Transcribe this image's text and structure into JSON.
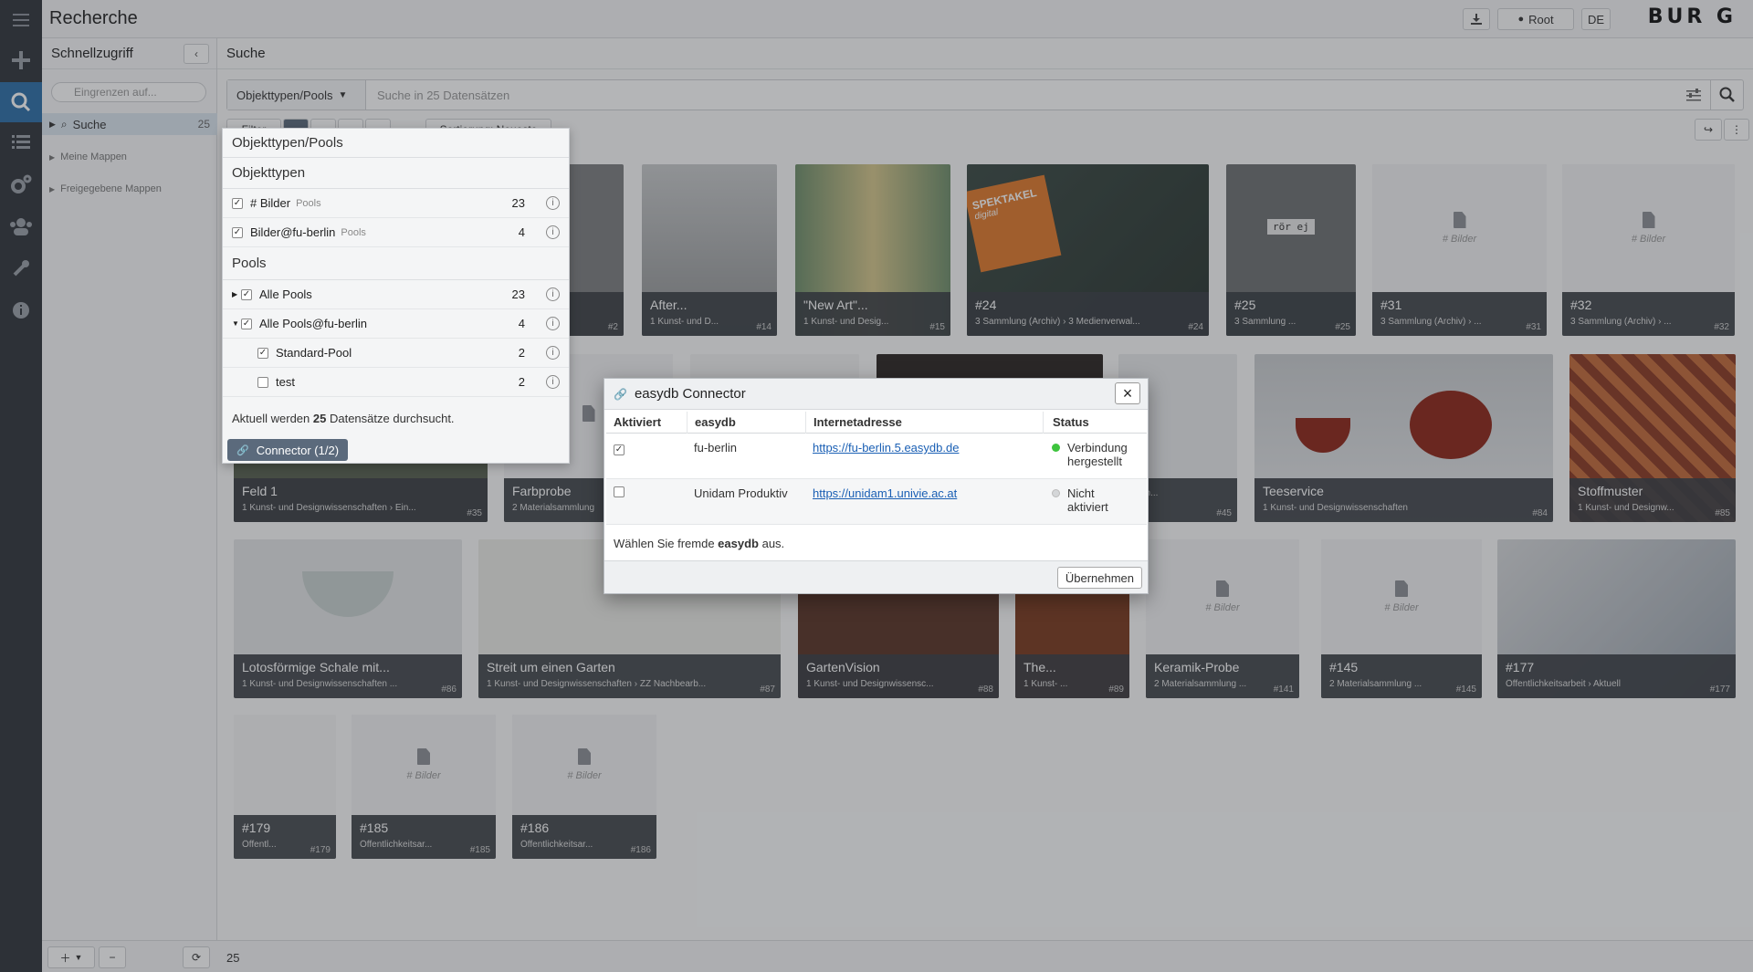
{
  "app": {
    "title": "Recherche",
    "user_label": "Root",
    "language": "DE",
    "logo_text": "BUR G"
  },
  "rail": {
    "items": [
      "menu-icon",
      "plus-icon",
      "search-icon",
      "list-icon",
      "gears-icon",
      "users-icon",
      "wrench-icon",
      "info-icon"
    ]
  },
  "left_panel": {
    "title": "Schnellzugriff",
    "filter_placeholder": "Eingrenzen auf...",
    "items": [
      {
        "label": "Suche",
        "count": "25"
      },
      {
        "label": "Meine Mappen"
      },
      {
        "label": "Freigegebene Mappen"
      }
    ]
  },
  "main": {
    "title": "Suche",
    "pool_select": "Objekttypen/Pools",
    "search_placeholder": "Suche in 25 Datensätzen",
    "filter_label": "Filter",
    "sort_label": "Sortierung: Neueste"
  },
  "tiles": [
    {
      "title": "",
      "sub": "",
      "num": "#2"
    },
    {
      "title": "After...",
      "sub": "1 Kunst- und D...",
      "num": "#14"
    },
    {
      "title": "\"New Art\"...",
      "sub": "1 Kunst- und Desig...",
      "num": "#15"
    },
    {
      "title": "#24",
      "sub": "3 Sammlung (Archiv) › 3 Medienverwal...",
      "num": "#24"
    },
    {
      "title": "#25",
      "sub": "3 Sammlung ...",
      "num": "#25"
    },
    {
      "title": "#31",
      "sub": "3 Sammlung (Archiv) › ...",
      "num": "#31",
      "ph": "# Bilder"
    },
    {
      "title": "#32",
      "sub": "3 Sammlung (Archiv) › ...",
      "num": "#32",
      "ph": "# Bilder"
    },
    {
      "title": "Feld 1",
      "sub": "1 Kunst- und Designwissenschaften › Ein...",
      "num": "#35"
    },
    {
      "title": "Farbprobe",
      "sub": "2 Materialsammlung",
      "num": ""
    },
    {
      "title": "",
      "sub": "...tlich...",
      "num": "#45"
    },
    {
      "title": "Teeservice",
      "sub": "1 Kunst- und Designwissenschaften",
      "num": "#84"
    },
    {
      "title": "Stoffmuster",
      "sub": "1 Kunst- und Designw...",
      "num": "#85"
    },
    {
      "title": "Lotosförmige Schale mit...",
      "sub": "1 Kunst- und Designwissenschaften ...",
      "num": "#86"
    },
    {
      "title": "Streit um einen Garten",
      "sub": "1 Kunst- und Designwissenschaften › ZZ Nachbearb...",
      "num": "#87"
    },
    {
      "title": "GartenVision",
      "sub": "1 Kunst- und Designwissensc...",
      "num": "#88"
    },
    {
      "title": "The...",
      "sub": "1 Kunst- ...",
      "num": "#89"
    },
    {
      "title": "Keramik-Probe",
      "sub": "2 Materialsammlung ...",
      "num": "#141",
      "ph": "# Bilder"
    },
    {
      "title": "#145",
      "sub": "2 Materialsammlung ...",
      "num": "#145",
      "ph": "# Bilder"
    },
    {
      "title": "#177",
      "sub": "Öffentlichkeitsarbeit › Aktuell",
      "num": "#177"
    },
    {
      "title": "#179",
      "sub": "Öffentl...",
      "num": "#179"
    },
    {
      "title": "#185",
      "sub": "Öffentlichkeitsar...",
      "num": "#185",
      "ph": "# Bilder"
    },
    {
      "title": "#186",
      "sub": "Öffentlichkeitsar...",
      "num": "#186",
      "ph": "# Bilder"
    }
  ],
  "tile_misc": {
    "spektakel": "SPEKTAKEL",
    "spektakel_sub": "digital",
    "sign": "rör ej"
  },
  "dropdown": {
    "header": "Objekttypen/Pools",
    "section_objtypes": "Objekttypen",
    "objtypes": [
      {
        "label": "# Bilder",
        "tag": "Pools",
        "count": "23",
        "checked": true
      },
      {
        "label": "Bilder@fu-berlin",
        "tag": "Pools",
        "count": "4",
        "checked": true
      }
    ],
    "section_pools": "Pools",
    "pools": [
      {
        "label": "Alle Pools",
        "count": "23",
        "checked": true,
        "level": 0,
        "arrow": "▶"
      },
      {
        "label": "Alle Pools@fu-berlin",
        "count": "4",
        "checked": true,
        "level": 0,
        "arrow": "▼"
      },
      {
        "label": "Standard-Pool",
        "count": "2",
        "checked": true,
        "level": 1
      },
      {
        "label": "test",
        "count": "2",
        "checked": false,
        "level": 1
      }
    ],
    "summary_pre": "Aktuell werden ",
    "summary_num": "25",
    "summary_post": " Datensätze durchsucht.",
    "connector_label": "Connector (1/2)"
  },
  "modal": {
    "title": "easydb Connector",
    "columns": [
      "Aktiviert",
      "easydb",
      "Internetadresse",
      "Status"
    ],
    "rows": [
      {
        "active": true,
        "name": "fu-berlin",
        "url": "https://fu-berlin.5.easydb.de",
        "status_line1": "Verbindung",
        "status_line2": "hergestellt",
        "status_color": "#3ec43e"
      },
      {
        "active": false,
        "name": "Unidam Produktiv",
        "url": "https://unidam1.univie.ac.at",
        "status_line1": "Nicht",
        "status_line2": "aktiviert",
        "status_color": "#d4d6d8"
      }
    ],
    "hint_pre": "Wählen Sie fremde ",
    "hint_bold": "easydb",
    "hint_post": " aus.",
    "apply_label": "Übernehmen"
  },
  "footer": {
    "count": "25"
  }
}
